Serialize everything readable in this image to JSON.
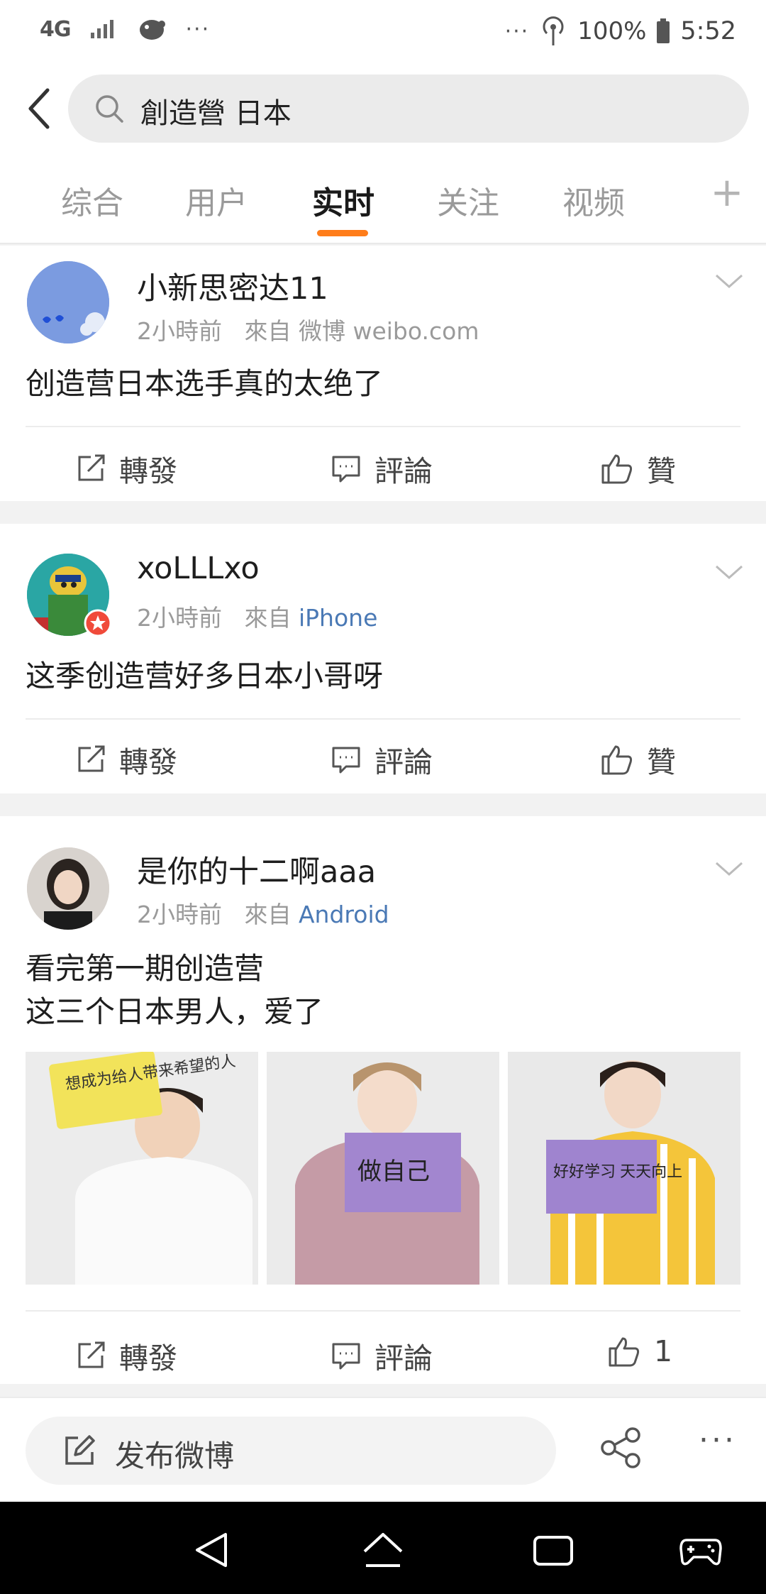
{
  "status_bar": {
    "network": "4G",
    "dots_left": "···",
    "dots_right": "···",
    "battery_pct": "100%",
    "time": "5:52"
  },
  "search": {
    "query": "創造營 日本"
  },
  "tabs": [
    {
      "label": "综合",
      "active": false
    },
    {
      "label": "用户",
      "active": false
    },
    {
      "label": "实时",
      "active": true
    },
    {
      "label": "关注",
      "active": false
    },
    {
      "label": "视频",
      "active": false
    }
  ],
  "tab_plus": "+",
  "posts": [
    {
      "username": "小新思密达11",
      "time": "2小時前",
      "from": "來自",
      "source": "微博 weibo.com",
      "source_is_link": false,
      "text": [
        "创造营日本选手真的太绝了"
      ],
      "actions": {
        "repost": "轉發",
        "comment": "評論",
        "like": "贊"
      }
    },
    {
      "username": "xoLLLxo",
      "time": "2小時前",
      "from": "來自",
      "source": "iPhone",
      "source_is_link": true,
      "text": [
        "这季创造营好多日本小哥呀"
      ],
      "actions": {
        "repost": "轉發",
        "comment": "評論",
        "like": "贊"
      }
    },
    {
      "username": "是你的十二啊aaa",
      "time": "2小時前",
      "from": "來自",
      "source": "Android",
      "source_is_link": true,
      "text": [
        "看完第一期创造营",
        "这三个日本男人，爱了"
      ],
      "photos": [
        {
          "sign_text": "想成为给人带来希望的人"
        },
        {
          "sign_text": "做自己"
        },
        {
          "sign_text": "好好学习 天天向上"
        }
      ],
      "actions": {
        "repost": "轉發",
        "comment": "評論",
        "like": "1"
      }
    }
  ],
  "bottom_bar": {
    "compose_label": "发布微博",
    "more": "···"
  },
  "colors": {
    "accent": "#ff7d1a",
    "link": "#4a79b5"
  }
}
